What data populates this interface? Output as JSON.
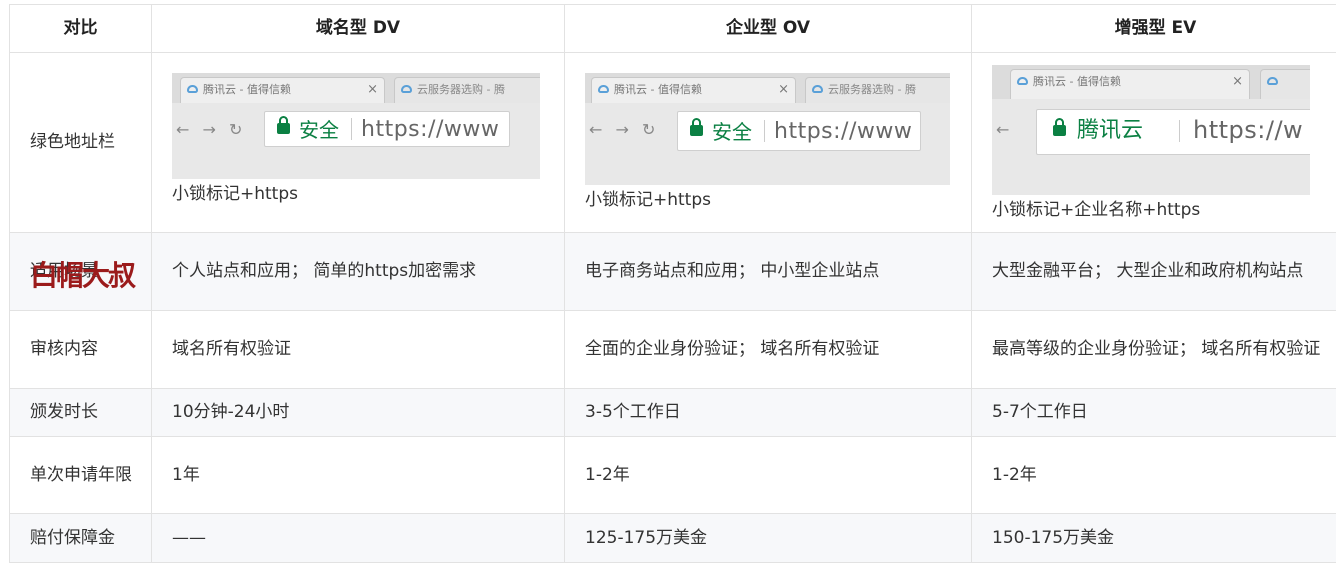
{
  "header": {
    "col1": "对比",
    "col2": "域名型 DV",
    "col3": "企业型 OV",
    "col4": "增强型 EV"
  },
  "rows": {
    "green_bar": {
      "label": "绿色地址栏",
      "dv": {
        "tab1": "腾讯云 - 值得信赖",
        "tab2": "云服务器选购 - 腾",
        "secure": "安全",
        "url": "https://www",
        "caption": "小锁标记+https"
      },
      "ov": {
        "tab1": "腾讯云 - 值得信赖",
        "tab2": "云服务器选购 - 腾",
        "secure": "安全",
        "url": "https://www",
        "caption": "小锁标记+https"
      },
      "ev": {
        "tab1": "腾讯云 - 值得信赖",
        "secure": "腾讯云",
        "url": "https://w",
        "caption": "小锁标记+企业名称+https"
      }
    },
    "scope": {
      "label": "适用场景",
      "dv": "个人站点和应用； 简单的https加密需求",
      "ov": "电子商务站点和应用； 中小型企业站点",
      "ev": "大型金融平台； 大型企业和政府机构站点"
    },
    "verify": {
      "label": "审核内容",
      "dv": "域名所有权验证",
      "ov": "全面的企业身份验证； 域名所有权验证",
      "ev": "最高等级的企业身份验证； 域名所有权验证"
    },
    "issue": {
      "label": "颁发时长",
      "dv": "10分钟-24小时",
      "ov": "3-5个工作日",
      "ev": "5-7个工作日"
    },
    "term": {
      "label": "单次申请年限",
      "dv": "1年",
      "ov": "1-2年",
      "ev": "1-2年"
    },
    "warranty": {
      "label": "赔付保障金",
      "dv": "——",
      "ov": "125-175万美金",
      "ev": "150-175万美金"
    }
  },
  "watermark": "白帽大叔",
  "colors": {
    "secure_green": "#0b8043",
    "watermark": "#9b1b1b",
    "alt_row": "#f7f8fa"
  }
}
